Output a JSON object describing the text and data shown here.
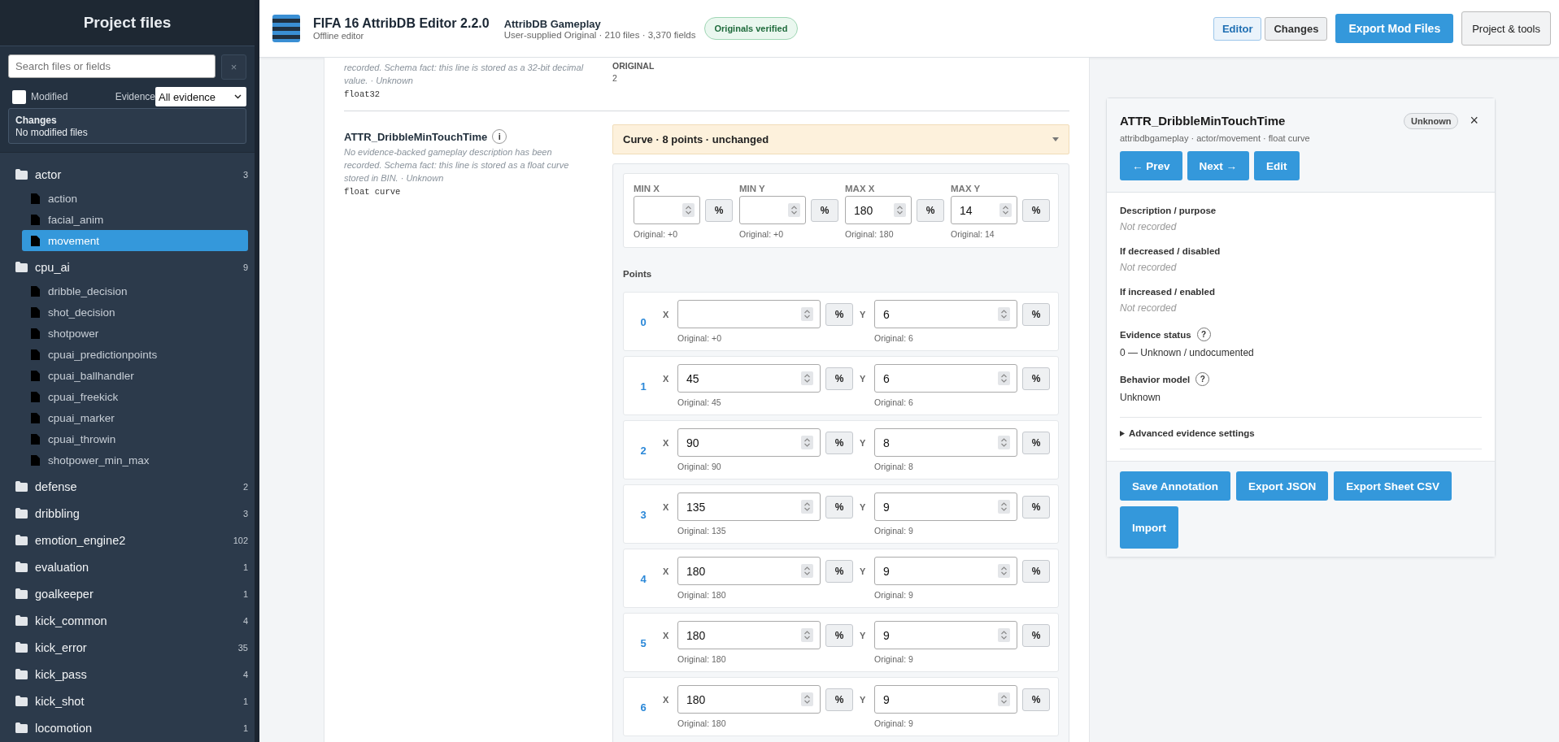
{
  "sidebar": {
    "title": "Project files",
    "search": {
      "placeholder": "Search files or fields"
    },
    "clear_button": "×",
    "modified_filter": {
      "label": "Modified",
      "checked": false
    },
    "evidence_filter": {
      "label": "Evidence",
      "value": "All evidence"
    },
    "changes": {
      "title": "Changes",
      "text": "No modified files"
    },
    "tree": [
      {
        "name": "actor",
        "count": "3",
        "children": [
          {
            "name": "action",
            "selected": false
          },
          {
            "name": "facial_anim",
            "selected": false
          },
          {
            "name": "movement",
            "selected": true
          }
        ]
      },
      {
        "name": "cpu_ai",
        "count": "9",
        "children": [
          {
            "name": "dribble_decision",
            "selected": false
          },
          {
            "name": "shot_decision",
            "selected": false
          },
          {
            "name": "shotpower",
            "selected": false
          },
          {
            "name": "cpuai_predictionpoints",
            "selected": false
          },
          {
            "name": "cpuai_ballhandler",
            "selected": false
          },
          {
            "name": "cpuai_freekick",
            "selected": false
          },
          {
            "name": "cpuai_marker",
            "selected": false
          },
          {
            "name": "cpuai_throwin",
            "selected": false
          },
          {
            "name": "shotpower_min_max",
            "selected": false
          }
        ]
      },
      {
        "name": "defense",
        "count": "2"
      },
      {
        "name": "dribbling",
        "count": "3"
      },
      {
        "name": "emotion_engine2",
        "count": "102"
      },
      {
        "name": "evaluation",
        "count": "1"
      },
      {
        "name": "goalkeeper",
        "count": "1"
      },
      {
        "name": "kick_common",
        "count": "4"
      },
      {
        "name": "kick_error",
        "count": "35"
      },
      {
        "name": "kick_pass",
        "count": "4"
      },
      {
        "name": "kick_shot",
        "count": "1"
      },
      {
        "name": "locomotion",
        "count": "1"
      }
    ]
  },
  "header": {
    "app_title": "FIFA 16 AttribDB Editor 2.2.0",
    "app_subtitle": "Offline editor",
    "project_name": "AttribDB Gameplay",
    "project_info": "User-supplied Original · 210 files · 3,370 fields",
    "badge": "Originals verified",
    "tabs": [
      {
        "label": "Editor",
        "selected": true
      },
      {
        "label": "Changes",
        "selected": false
      }
    ],
    "buttons": [
      {
        "label": "Export Mod Files",
        "kind": "primary"
      },
      {
        "label": "Project & tools",
        "kind": "secondary"
      }
    ]
  },
  "previous_field": {
    "description": "recorded. Schema fact: this line is stored as a 32-bit decimal value. · Unknown",
    "type": "float32",
    "original_label": "ORIGINAL",
    "original_value": "2"
  },
  "field": {
    "name": "ATTR_DribbleMinTouchTime",
    "info_icon": "i",
    "description": "No evidence-backed gameplay description has been recorded. Schema fact: this line is stored as a float curve stored in BIN. · Unknown",
    "type": "float curve",
    "curve_summary": "Curve · 8 points · unchanged",
    "expanded": true,
    "bounds": [
      {
        "label": "MIN X",
        "original": "Original: +0",
        "percent_button": "%"
      },
      {
        "label": "MIN Y",
        "original": "Original: +0",
        "percent_button": "%"
      },
      {
        "label": "MAX X",
        "value": "180",
        "original": "Original: 180",
        "percent_button": "%"
      },
      {
        "label": "MAX Y",
        "value": "14",
        "original": "Original: 14",
        "percent_button": "%"
      }
    ],
    "points_label": "Points",
    "points": [
      {
        "index": "0",
        "x": {
          "label": "X",
          "original": "Original: +0",
          "percent_button": "%"
        },
        "y": {
          "label": "Y",
          "value": "6",
          "original": "Original: 6",
          "percent_button": "%"
        }
      },
      {
        "index": "1",
        "x": {
          "label": "X",
          "value": "45",
          "original": "Original: 45",
          "percent_button": "%"
        },
        "y": {
          "label": "Y",
          "value": "6",
          "original": "Original: 6",
          "percent_button": "%"
        }
      },
      {
        "index": "2",
        "x": {
          "label": "X",
          "value": "90",
          "original": "Original: 90",
          "percent_button": "%"
        },
        "y": {
          "label": "Y",
          "value": "8",
          "original": "Original: 8",
          "percent_button": "%"
        }
      },
      {
        "index": "3",
        "x": {
          "label": "X",
          "value": "135",
          "original": "Original: 135",
          "percent_button": "%"
        },
        "y": {
          "label": "Y",
          "value": "9",
          "original": "Original: 9",
          "percent_button": "%"
        }
      },
      {
        "index": "4",
        "x": {
          "label": "X",
          "value": "180",
          "original": "Original: 180",
          "percent_button": "%"
        },
        "y": {
          "label": "Y",
          "value": "9",
          "original": "Original: 9",
          "percent_button": "%"
        }
      },
      {
        "index": "5",
        "x": {
          "label": "X",
          "value": "180",
          "original": "Original: 180",
          "percent_button": "%"
        },
        "y": {
          "label": "Y",
          "value": "9",
          "original": "Original: 9",
          "percent_button": "%"
        }
      },
      {
        "index": "6",
        "x": {
          "label": "X",
          "value": "180",
          "original": "Original: 180",
          "percent_button": "%"
        },
        "y": {
          "label": "Y",
          "value": "9",
          "original": "Original: 9",
          "percent_button": "%"
        }
      }
    ]
  },
  "detail_panel": {
    "title": "ATTR_DribbleMinTouchTime",
    "status_badge": "Unknown",
    "close_button": "×",
    "path": "attribdbgameplay · actor/movement · float curve",
    "nav_buttons": [
      "← Prev",
      "Next →",
      "Edit"
    ],
    "sections": [
      {
        "label": "Description / purpose",
        "value": "Not recorded",
        "kind": "missing"
      },
      {
        "label": "If decreased / disabled",
        "value": "Not recorded",
        "kind": "missing"
      },
      {
        "label": "If increased / enabled",
        "value": "Not recorded",
        "kind": "missing"
      },
      {
        "label": "Evidence status",
        "help": "?",
        "value": "0 — Unknown / undocumented",
        "kind": "text"
      },
      {
        "label": "Behavior model",
        "help": "?",
        "value": "Unknown",
        "kind": "text"
      }
    ],
    "advanced": {
      "label": "Advanced evidence settings",
      "expanded": false
    },
    "actions": [
      "Save Annotation",
      "Export JSON",
      "Export Sheet CSV",
      "Import"
    ]
  }
}
